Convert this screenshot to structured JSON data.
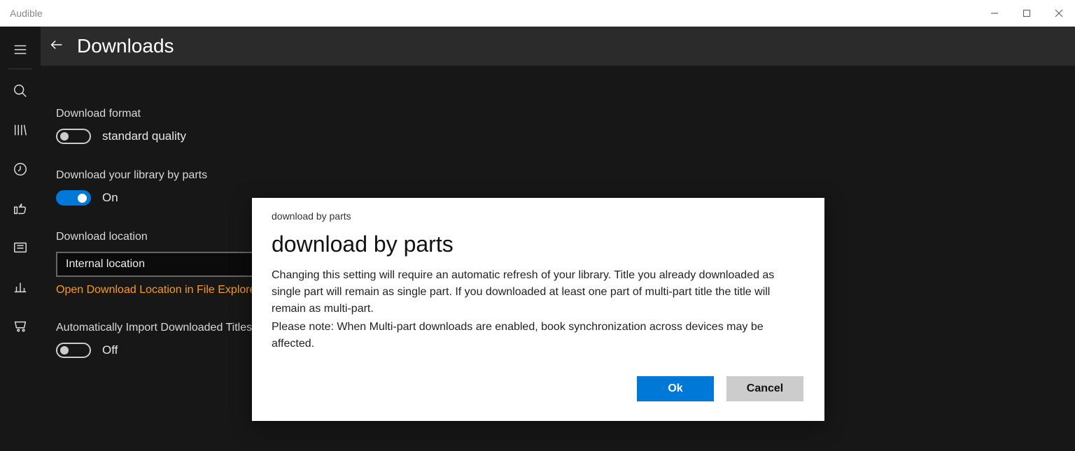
{
  "window": {
    "title": "Audible"
  },
  "header": {
    "title": "Downloads"
  },
  "settings": {
    "format": {
      "label": "Download format",
      "value": "standard quality",
      "state": "off"
    },
    "by_parts": {
      "label": "Download your library by parts",
      "value": "On",
      "state": "on"
    },
    "location": {
      "label": "Download location",
      "value": "Internal location",
      "link": "Open Download Location in File Explorer"
    },
    "auto_import": {
      "label": "Automatically Import Downloaded Titles",
      "value": "Off",
      "state": "off"
    }
  },
  "dialog": {
    "caption": "download by parts",
    "title": "download by parts",
    "body1": "Changing this setting will require an automatic refresh of your library. Title you already downloaded as single part will remain as single part. If you downloaded at least one part of multi-part title the title will remain as multi-part.",
    "body2": "Please note: When Multi-part downloads are enabled, book synchronization across devices may be affected.",
    "ok": "Ok",
    "cancel": "Cancel"
  }
}
